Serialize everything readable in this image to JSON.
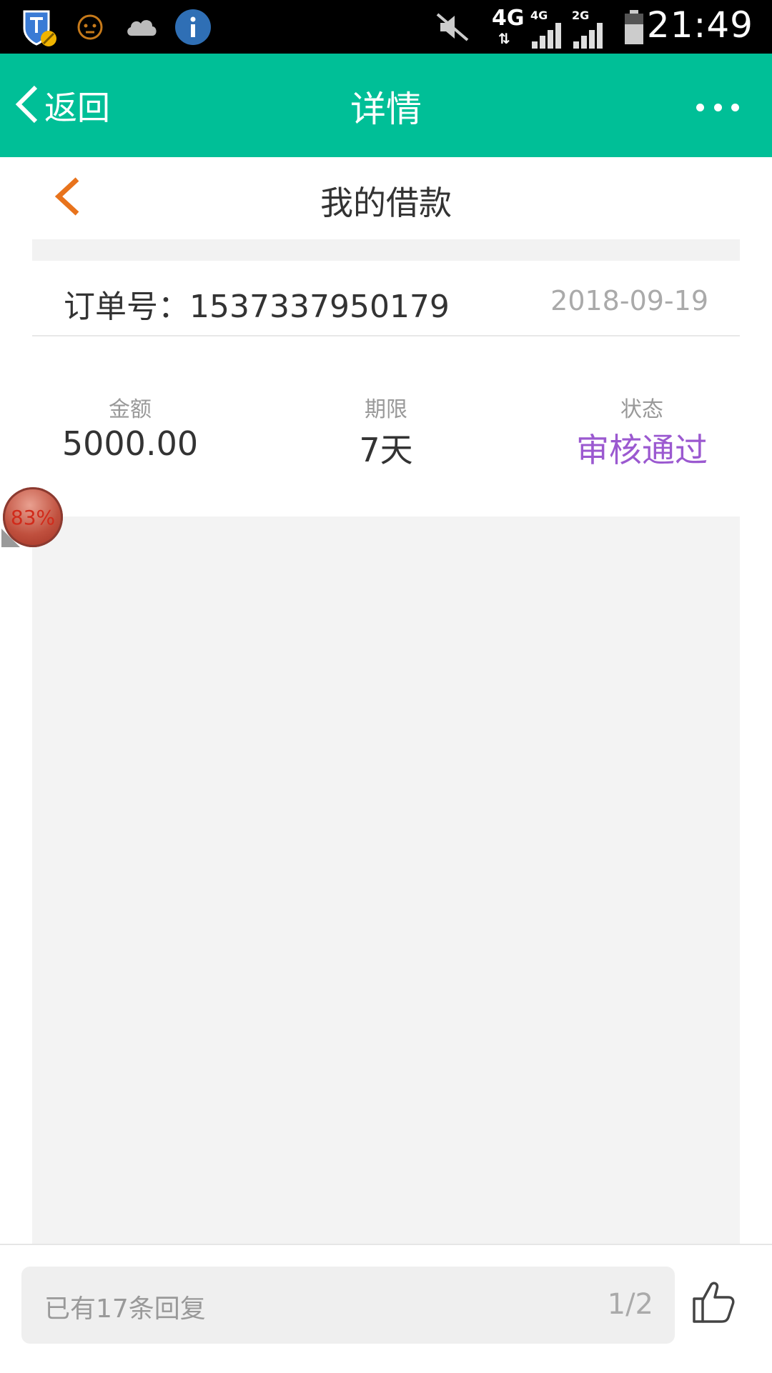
{
  "status_bar": {
    "time": "21:49",
    "network_main": "4G",
    "network_sim1": "4G",
    "network_sim2": "2G",
    "icons": [
      "shield-icon",
      "face-icon",
      "cloud-icon",
      "info-icon",
      "mute-icon",
      "signal-icon",
      "battery-icon"
    ]
  },
  "nav": {
    "back_label": "返回",
    "title": "详情"
  },
  "page": {
    "title": "我的借款"
  },
  "order": {
    "label": "订单号：1537337950179",
    "date": "2018-09-19"
  },
  "summary": [
    {
      "label": "金额",
      "value": "5000.00"
    },
    {
      "label": "期限",
      "value": "7天"
    },
    {
      "label": "状态",
      "value": "审核通过"
    }
  ],
  "progress": {
    "text": "83%"
  },
  "bottom": {
    "reply_text": "已有17条回复",
    "page_indicator": "1/2"
  },
  "colors": {
    "nav_bg": "#00bf97",
    "accent_back": "#e8731c",
    "status_value": "#9b59d0"
  }
}
